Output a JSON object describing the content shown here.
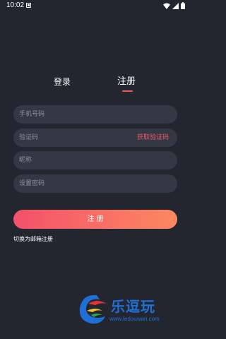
{
  "status_bar": {
    "time": "10:02"
  },
  "tabs": {
    "login_label": "登录",
    "register_label": "注册",
    "active": "register"
  },
  "form": {
    "phone_placeholder": "手机号码",
    "code_placeholder": "验证码",
    "get_code_label": "获取验证码",
    "nickname_placeholder": "昵称",
    "password_placeholder": "设置密码"
  },
  "actions": {
    "register_label": "注 册",
    "switch_email_label": "切换为邮箱注册"
  },
  "watermark": {
    "title": "乐逗玩",
    "url": "www.ledouwan.com"
  },
  "colors": {
    "background": "#23252f",
    "field": "#353844",
    "accent": "#f05a63",
    "button_gradient_start": "#f4506a",
    "button_gradient_end": "#fb8860",
    "watermark": "#1f6fd6"
  },
  "icons": [
    "notification-icon",
    "wifi-icon",
    "signal-icon",
    "battery-icon"
  ]
}
